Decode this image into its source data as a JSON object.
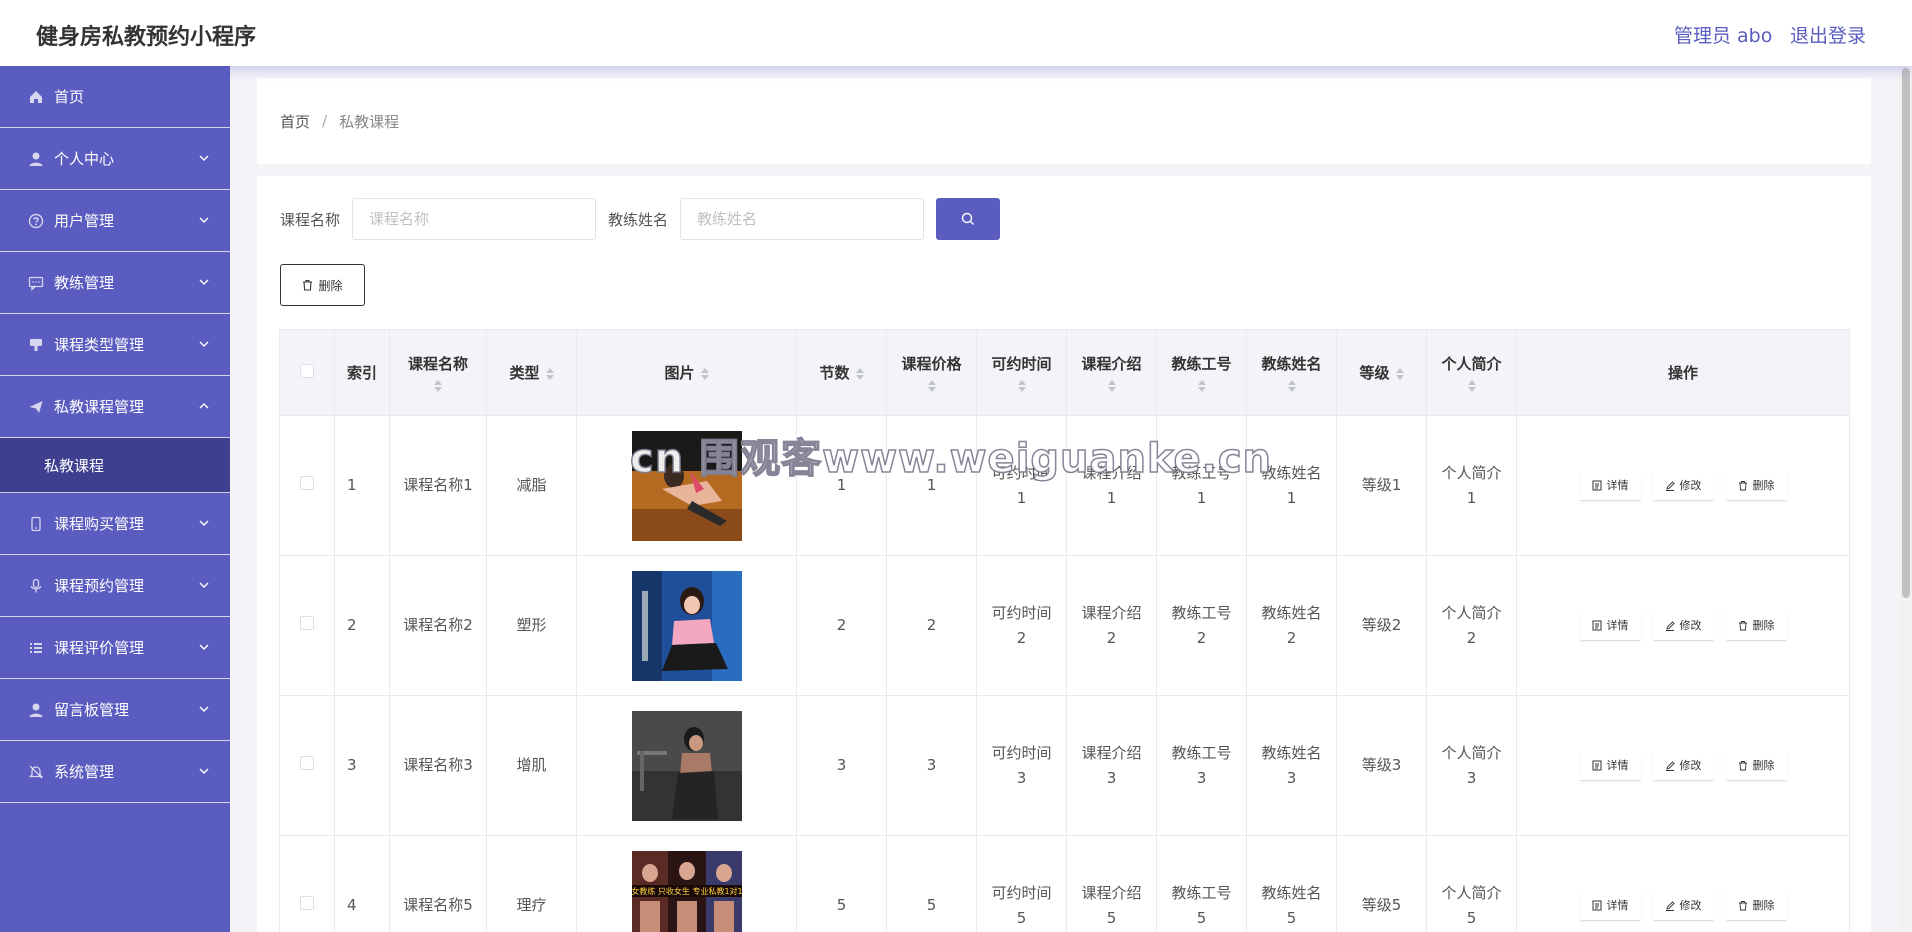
{
  "header": {
    "title": "健身房私教预约小程序",
    "admin": "管理员 abo",
    "logout": "退出登录"
  },
  "sidebar": {
    "items": [
      {
        "label": "首页",
        "icon": "home-icon",
        "expandable": false
      },
      {
        "label": "个人中心",
        "icon": "user-icon",
        "expandable": true
      },
      {
        "label": "用户管理",
        "icon": "help-circle-icon",
        "expandable": true
      },
      {
        "label": "教练管理",
        "icon": "chat-icon",
        "expandable": true
      },
      {
        "label": "课程类型管理",
        "icon": "stamp-icon",
        "expandable": true
      },
      {
        "label": "私教课程管理",
        "icon": "send-icon",
        "expandable": true,
        "expanded": true
      },
      {
        "label": "课程购买管理",
        "icon": "phone-icon",
        "expandable": true
      },
      {
        "label": "课程预约管理",
        "icon": "mic-icon",
        "expandable": true
      },
      {
        "label": "课程评价管理",
        "icon": "list-icon",
        "expandable": true
      },
      {
        "label": "留言板管理",
        "icon": "user-icon",
        "expandable": true
      },
      {
        "label": "系统管理",
        "icon": "bell-off-icon",
        "expandable": true
      }
    ],
    "submenu": {
      "label": "私教课程"
    }
  },
  "breadcrumb": {
    "home": "首页",
    "separator": "/",
    "current": "私教课程"
  },
  "search": {
    "course_label": "课程名称",
    "course_placeholder": "课程名称",
    "coach_label": "教练姓名",
    "coach_placeholder": "教练姓名"
  },
  "actions": {
    "bulk_delete": "删除"
  },
  "table": {
    "headers": [
      "索引",
      "课程名称",
      "类型",
      "图片",
      "节数",
      "课程价格",
      "可约时间",
      "课程介绍",
      "教练工号",
      "教练姓名",
      "等级",
      "个人简介",
      "操作"
    ],
    "rows": [
      {
        "index": "1",
        "name": "课程名称1",
        "type": "减脂",
        "image": "thumb-1",
        "sessions": "1",
        "price": "1",
        "time": [
          "可约时间",
          "1"
        ],
        "intro": [
          "课程介绍",
          "1"
        ],
        "coach_no": [
          "教练工号",
          "1"
        ],
        "coach_name": [
          "教练姓名",
          "1"
        ],
        "level": "等级1",
        "bio": [
          "个人简介",
          "1"
        ]
      },
      {
        "index": "2",
        "name": "课程名称2",
        "type": "塑形",
        "image": "thumb-2",
        "sessions": "2",
        "price": "2",
        "time": [
          "可约时间",
          "2"
        ],
        "intro": [
          "课程介绍",
          "2"
        ],
        "coach_no": [
          "教练工号",
          "2"
        ],
        "coach_name": [
          "教练姓名",
          "2"
        ],
        "level": "等级2",
        "bio": [
          "个人简介",
          "2"
        ]
      },
      {
        "index": "3",
        "name": "课程名称3",
        "type": "增肌",
        "image": "thumb-3",
        "sessions": "3",
        "price": "3",
        "time": [
          "可约时间",
          "3"
        ],
        "intro": [
          "课程介绍",
          "3"
        ],
        "coach_no": [
          "教练工号",
          "3"
        ],
        "coach_name": [
          "教练姓名",
          "3"
        ],
        "level": "等级3",
        "bio": [
          "个人简介",
          "3"
        ]
      },
      {
        "index": "4",
        "name": "课程名称5",
        "type": "理疗",
        "image": "thumb-4",
        "sessions": "5",
        "price": "5",
        "time": [
          "可约时间",
          "5"
        ],
        "intro": [
          "课程介绍",
          "5"
        ],
        "coach_no": [
          "教练工号",
          "5"
        ],
        "coach_name": [
          "教练姓名",
          "5"
        ],
        "level": "等级5",
        "bio": [
          "个人简介",
          "5"
        ]
      }
    ],
    "ops": {
      "detail": "详情",
      "edit": "修改",
      "delete": "删除"
    }
  },
  "watermark": "cn 围观客www.weiguanke.cn",
  "thumb_banner": "女教练 只收女生 专业私教1对1",
  "colors": {
    "accent": "#5b5cc0",
    "submenu_bg": "#3e3f8f",
    "header_bg": "#f4f4f8"
  }
}
